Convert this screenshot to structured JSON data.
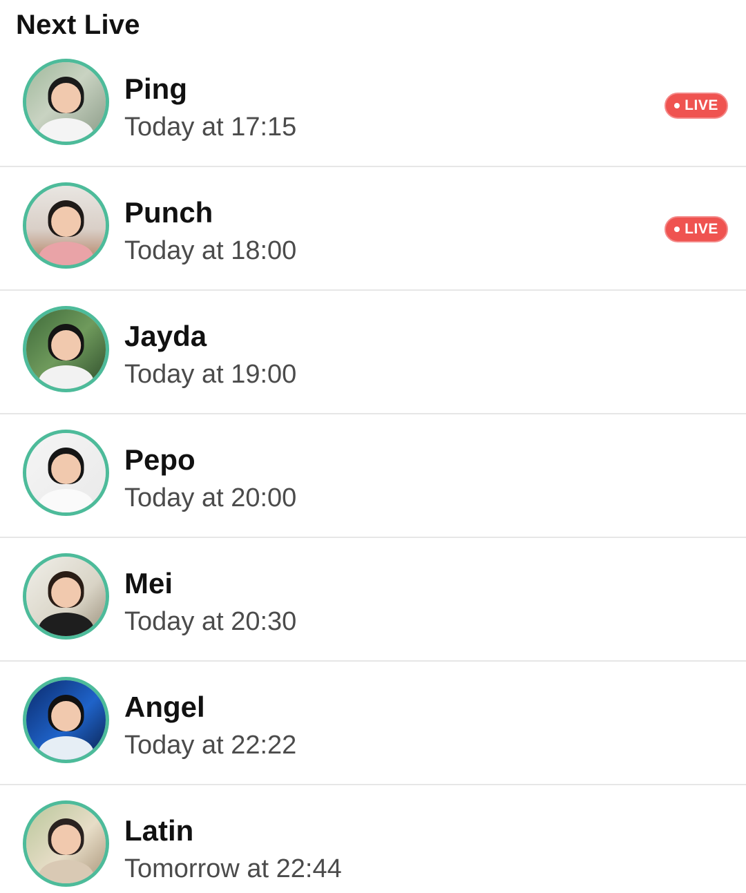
{
  "header": {
    "title": "Next Live"
  },
  "accent": {
    "avatar_ring": "#4dbb9a",
    "live_badge": "#ef5350"
  },
  "items": [
    {
      "name": "Ping",
      "time": "Today at 17:15",
      "live": true,
      "live_label": "LIVE",
      "bg": "linear-gradient(135deg,#9fb89b 0%,#c9d3c2 45%,#8a9a86 100%)",
      "hair": "#1a1a1a",
      "shirt": "#f4f4f4"
    },
    {
      "name": "Punch",
      "time": "Today at 18:00",
      "live": true,
      "live_label": "LIVE",
      "bg": "linear-gradient(180deg,#e9e6e2 0%,#d9cfc7 55%,#b07a5b 100%)",
      "hair": "#1f1a18",
      "shirt": "#e9a3a7"
    },
    {
      "name": "Jayda",
      "time": "Today at 19:00",
      "live": false,
      "live_label": "",
      "bg": "linear-gradient(135deg,#3e6a3a 0%,#6f9a5c 50%,#2e4d2b 100%)",
      "hair": "#141414",
      "shirt": "#f2f2f2"
    },
    {
      "name": "Pepo",
      "time": "Today at 20:00",
      "live": false,
      "live_label": "",
      "bg": "linear-gradient(135deg,#f5f5f5 0%,#e9e9e9 100%)",
      "hair": "#151515",
      "shirt": "#fafafa"
    },
    {
      "name": "Mei",
      "time": "Today at 20:30",
      "live": false,
      "live_label": "",
      "bg": "linear-gradient(135deg,#f0efe9 0%,#d9d4c6 60%,#9a8f7a 100%)",
      "hair": "#2a1d16",
      "shirt": "#1e1e1e"
    },
    {
      "name": "Angel",
      "time": "Today at 22:22",
      "live": false,
      "live_label": "",
      "bg": "linear-gradient(135deg,#0b2a6b 0%,#1f63c9 55%,#0a1f4a 100%)",
      "hair": "#111111",
      "shirt": "#e6eef5"
    },
    {
      "name": "Latin",
      "time": "Tomorrow at 22:44",
      "live": false,
      "live_label": "",
      "bg": "linear-gradient(135deg,#b9c79b 0%,#e7ddc7 55%,#a99479 100%)",
      "hair": "#2a2220",
      "shirt": "#d9c9b4"
    }
  ]
}
